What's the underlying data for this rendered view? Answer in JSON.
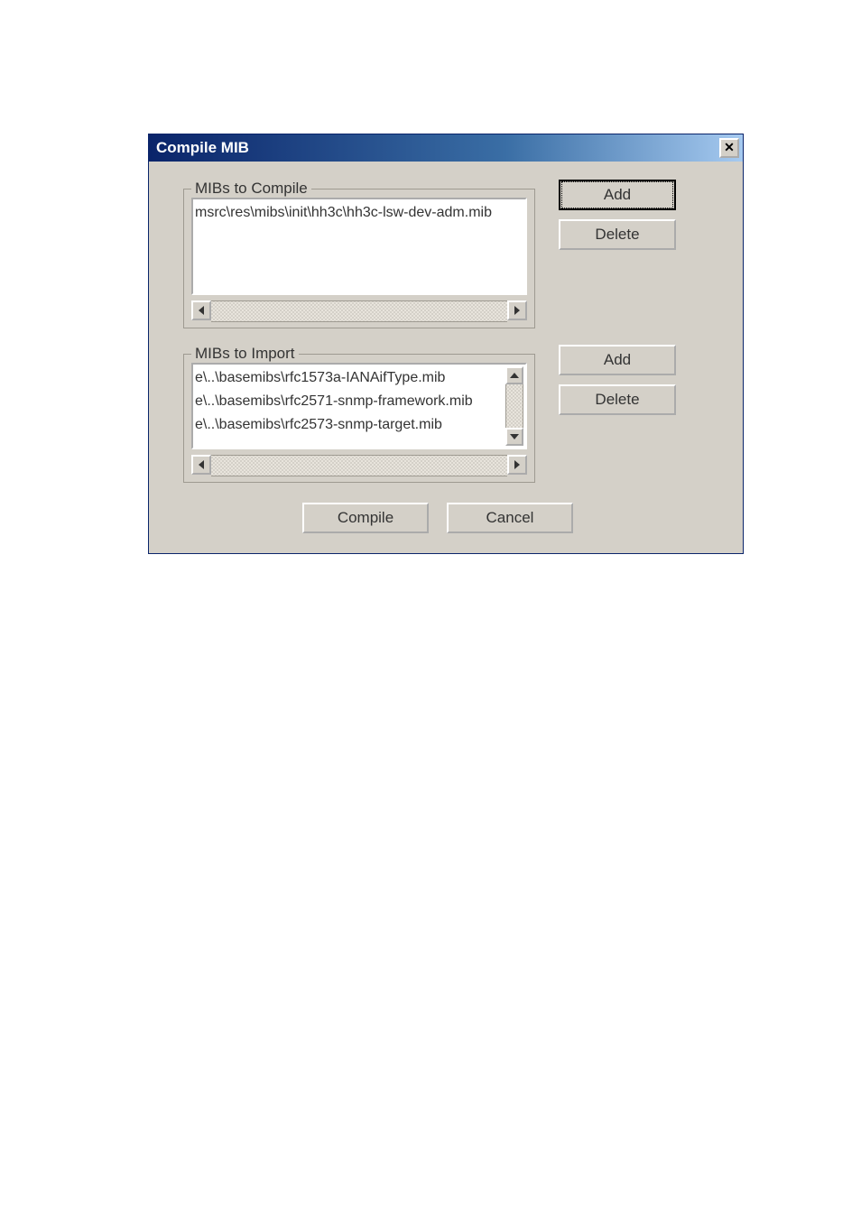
{
  "window": {
    "title": "Compile MIB",
    "close_symbol": "✕"
  },
  "groups": {
    "compile": {
      "legend": "MIBs to Compile",
      "items": [
        "msrc\\res\\mibs\\init\\hh3c\\hh3c-lsw-dev-adm.mib"
      ],
      "buttons": {
        "add": "Add",
        "delete": "Delete"
      }
    },
    "import": {
      "legend": "MIBs to Import",
      "items": [
        "e\\..\\basemibs\\rfc1573a-IANAifType.mib",
        "e\\..\\basemibs\\rfc2571-snmp-framework.mib",
        "e\\..\\basemibs\\rfc2573-snmp-target.mib"
      ],
      "buttons": {
        "add": "Add",
        "delete": "Delete"
      }
    }
  },
  "actions": {
    "compile": "Compile",
    "cancel": "Cancel"
  }
}
